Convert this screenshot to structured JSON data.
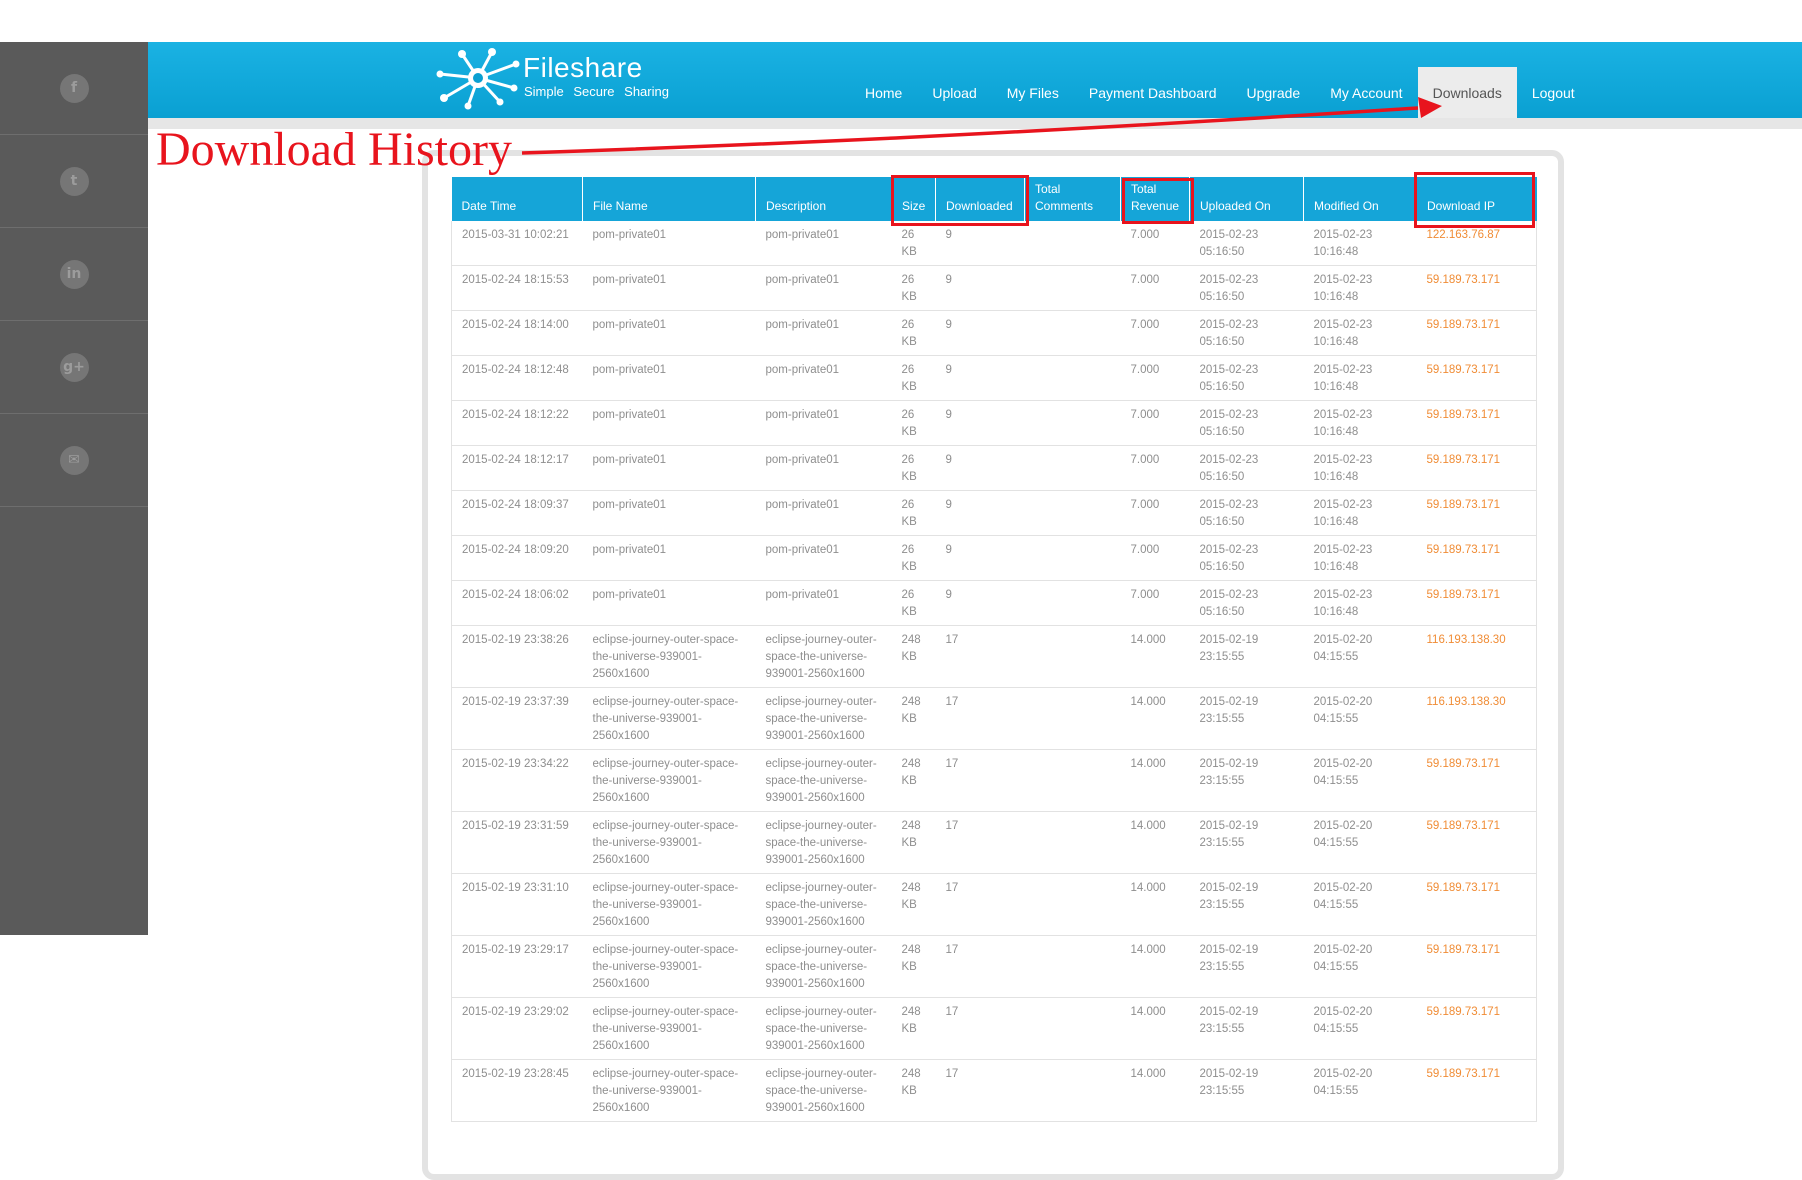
{
  "social": [
    {
      "name": "facebook-icon",
      "glyph": "f"
    },
    {
      "name": "twitter-icon",
      "glyph": "t"
    },
    {
      "name": "linkedin-icon",
      "glyph": "in"
    },
    {
      "name": "google-plus-icon",
      "glyph": "g+"
    },
    {
      "name": "email-icon",
      "glyph": "✉"
    }
  ],
  "header": {
    "logo_title": "Fileshare",
    "logo_tagline": "Simple  Secure  Sharing"
  },
  "nav": {
    "items": [
      "Home",
      "Upload",
      "My Files",
      "Payment Dashboard",
      "Upgrade",
      "My Account",
      "Downloads",
      "Logout"
    ],
    "active": "Downloads"
  },
  "annotation": {
    "label": "Download History",
    "color": "#e8141d"
  },
  "colors": {
    "header_blue": "#1ab2e3",
    "table_header": "#15a5d8",
    "ip_orange": "#f08c35"
  },
  "table": {
    "columns": [
      "Date Time",
      "File Name",
      "Description",
      "Size",
      "Downloaded",
      "Total Comments",
      "Total Revenue",
      "Uploaded On",
      "Modified On",
      "Download IP"
    ],
    "highlighted_columns": [
      "Size",
      "Downloaded",
      "Total Revenue",
      "Download IP"
    ],
    "rows": [
      [
        "2015-03-31 10:02:21",
        "pom-private01",
        "pom-private01",
        "26 KB",
        "9",
        "",
        "7.000",
        "2015-02-23 05:16:50",
        "2015-02-23 10:16:48",
        "122.163.76.87"
      ],
      [
        "2015-02-24 18:15:53",
        "pom-private01",
        "pom-private01",
        "26 KB",
        "9",
        "",
        "7.000",
        "2015-02-23 05:16:50",
        "2015-02-23 10:16:48",
        "59.189.73.171"
      ],
      [
        "2015-02-24 18:14:00",
        "pom-private01",
        "pom-private01",
        "26 KB",
        "9",
        "",
        "7.000",
        "2015-02-23 05:16:50",
        "2015-02-23 10:16:48",
        "59.189.73.171"
      ],
      [
        "2015-02-24 18:12:48",
        "pom-private01",
        "pom-private01",
        "26 KB",
        "9",
        "",
        "7.000",
        "2015-02-23 05:16:50",
        "2015-02-23 10:16:48",
        "59.189.73.171"
      ],
      [
        "2015-02-24 18:12:22",
        "pom-private01",
        "pom-private01",
        "26 KB",
        "9",
        "",
        "7.000",
        "2015-02-23 05:16:50",
        "2015-02-23 10:16:48",
        "59.189.73.171"
      ],
      [
        "2015-02-24 18:12:17",
        "pom-private01",
        "pom-private01",
        "26 KB",
        "9",
        "",
        "7.000",
        "2015-02-23 05:16:50",
        "2015-02-23 10:16:48",
        "59.189.73.171"
      ],
      [
        "2015-02-24 18:09:37",
        "pom-private01",
        "pom-private01",
        "26 KB",
        "9",
        "",
        "7.000",
        "2015-02-23 05:16:50",
        "2015-02-23 10:16:48",
        "59.189.73.171"
      ],
      [
        "2015-02-24 18:09:20",
        "pom-private01",
        "pom-private01",
        "26 KB",
        "9",
        "",
        "7.000",
        "2015-02-23 05:16:50",
        "2015-02-23 10:16:48",
        "59.189.73.171"
      ],
      [
        "2015-02-24 18:06:02",
        "pom-private01",
        "pom-private01",
        "26 KB",
        "9",
        "",
        "7.000",
        "2015-02-23 05:16:50",
        "2015-02-23 10:16:48",
        "59.189.73.171"
      ],
      [
        "2015-02-19 23:38:26",
        "eclipse-journey-outer-space-the-universe-939001-2560x1600",
        "eclipse-journey-outer-space-the-universe-939001-2560x1600",
        "248 KB",
        "17",
        "",
        "14.000",
        "2015-02-19 23:15:55",
        "2015-02-20 04:15:55",
        "116.193.138.30"
      ],
      [
        "2015-02-19 23:37:39",
        "eclipse-journey-outer-space-the-universe-939001-2560x1600",
        "eclipse-journey-outer-space-the-universe-939001-2560x1600",
        "248 KB",
        "17",
        "",
        "14.000",
        "2015-02-19 23:15:55",
        "2015-02-20 04:15:55",
        "116.193.138.30"
      ],
      [
        "2015-02-19 23:34:22",
        "eclipse-journey-outer-space-the-universe-939001-2560x1600",
        "eclipse-journey-outer-space-the-universe-939001-2560x1600",
        "248 KB",
        "17",
        "",
        "14.000",
        "2015-02-19 23:15:55",
        "2015-02-20 04:15:55",
        "59.189.73.171"
      ],
      [
        "2015-02-19 23:31:59",
        "eclipse-journey-outer-space-the-universe-939001-2560x1600",
        "eclipse-journey-outer-space-the-universe-939001-2560x1600",
        "248 KB",
        "17",
        "",
        "14.000",
        "2015-02-19 23:15:55",
        "2015-02-20 04:15:55",
        "59.189.73.171"
      ],
      [
        "2015-02-19 23:31:10",
        "eclipse-journey-outer-space-the-universe-939001-2560x1600",
        "eclipse-journey-outer-space-the-universe-939001-2560x1600",
        "248 KB",
        "17",
        "",
        "14.000",
        "2015-02-19 23:15:55",
        "2015-02-20 04:15:55",
        "59.189.73.171"
      ],
      [
        "2015-02-19 23:29:17",
        "eclipse-journey-outer-space-the-universe-939001-2560x1600",
        "eclipse-journey-outer-space-the-universe-939001-2560x1600",
        "248 KB",
        "17",
        "",
        "14.000",
        "2015-02-19 23:15:55",
        "2015-02-20 04:15:55",
        "59.189.73.171"
      ],
      [
        "2015-02-19 23:29:02",
        "eclipse-journey-outer-space-the-universe-939001-2560x1600",
        "eclipse-journey-outer-space-the-universe-939001-2560x1600",
        "248 KB",
        "17",
        "",
        "14.000",
        "2015-02-19 23:15:55",
        "2015-02-20 04:15:55",
        "59.189.73.171"
      ],
      [
        "2015-02-19 23:28:45",
        "eclipse-journey-outer-space-the-universe-939001-2560x1600",
        "eclipse-journey-outer-space-the-universe-939001-2560x1600",
        "248 KB",
        "17",
        "",
        "14.000",
        "2015-02-19 23:15:55",
        "2015-02-20 04:15:55",
        "59.189.73.171"
      ]
    ]
  }
}
